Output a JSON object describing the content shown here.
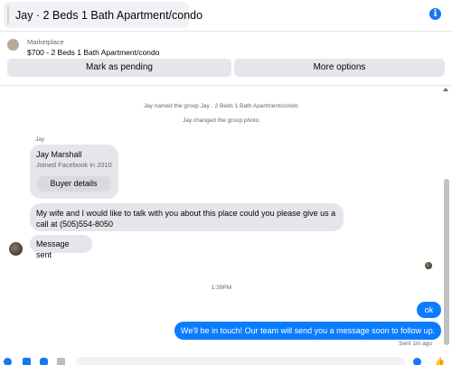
{
  "header": {
    "title": "Jay · 2 Beds 1 Bath Apartment/condo",
    "info_icon": "info-icon",
    "accent": "#1877f2"
  },
  "marketplace": {
    "label": "Marketplace",
    "listing": "$700 - 2 Beds 1 Bath Apartment/condo",
    "buttons": {
      "pending": "Mark as pending",
      "more": "More options"
    }
  },
  "conversation": {
    "system_messages": [
      "Jay named the group Jay · 2 Beds 1 Bath Apartment/condo.",
      "Jay changed the group photo."
    ],
    "sender_name": "Jay",
    "profile_card": {
      "name": "Jay Marshall",
      "subtitle": "Joined Facebook in 2010",
      "button": "Buyer details"
    },
    "incoming": [
      "My wife and I  would like to talk with you about this place could you please give us a call  at (505)554-8050",
      "Message sent"
    ],
    "time_separator": "1:39PM",
    "outgoing": [
      "ok",
      "We'll be in touch! Our team will send you a message soon to follow up."
    ],
    "status": "Sent 1m ago",
    "outgoing_color": "#0a7cff"
  },
  "composer": {
    "icons": [
      "plus-icon",
      "image-icon",
      "sticker-icon",
      "gif-icon",
      "emoji-icon",
      "like-icon"
    ]
  }
}
